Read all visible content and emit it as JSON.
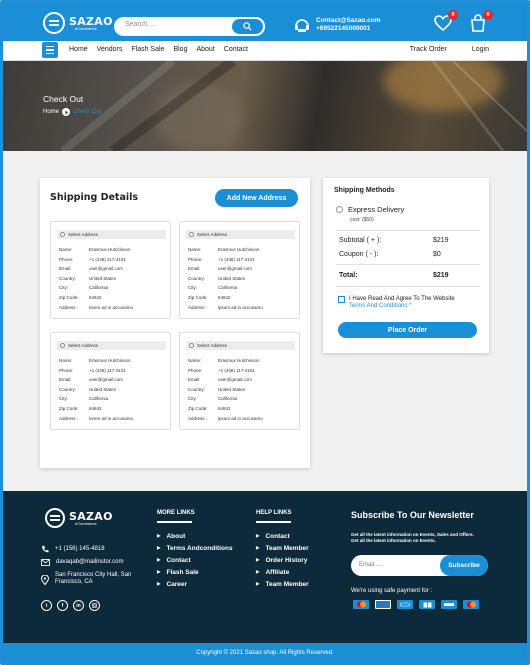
{
  "brand": {
    "name": "SAZAO",
    "tagline": "eCommerce"
  },
  "header": {
    "search_placeholder": "Search.....",
    "email": "Contact@Sazao.com",
    "phone": "+69522145000001",
    "wishlist_count": "0",
    "cart_count": "0"
  },
  "nav": {
    "links": [
      "Home",
      "Vendors",
      "Flash Sale",
      "Blog",
      "About",
      "Contact"
    ],
    "track_order": "Track Order",
    "login": "Login"
  },
  "hero": {
    "title": "Check Out",
    "crumb_home": "Home",
    "crumb_current": "Check Out"
  },
  "shipping": {
    "title": "Shipping Details",
    "add_button": "Add New Address",
    "addresses": [
      {
        "select": "Select Address",
        "name_k": "Name:",
        "name": "Erasmus Hutchinson",
        "phone_k": "Phone:",
        "phone": "+1 (448) 117-4101",
        "email_k": "Email:",
        "email": "user@gmail.com",
        "country_k": "Country:",
        "country": "United States",
        "city_k": "City:",
        "city": "California",
        "zip_k": "Zip Code:",
        "zip": "64842",
        "address_k": "Address :",
        "address": "lorem ad in accusamu"
      },
      {
        "select": "Select Address",
        "name_k": "Name:",
        "name": "Erasmus Hutchinson",
        "phone_k": "Phone:",
        "phone": "+1 (448) 117-4101",
        "email_k": "Email:",
        "email": "user@gmail.com",
        "country_k": "Country:",
        "country": "United States",
        "city_k": "City:",
        "city": "California",
        "zip_k": "Zip Code:",
        "zip": "64842",
        "address_k": "Address :",
        "address": "lpsum ad in accusamu"
      },
      {
        "select": "Select Address",
        "name_k": "Name:",
        "name": "Erasmus Hutchinson",
        "phone_k": "Phone:",
        "phone": "+1 (448) 117-4101",
        "email_k": "Email:",
        "email": "user@gmail.com",
        "country_k": "Country:",
        "country": "United States",
        "city_k": "City:",
        "city": "California",
        "zip_k": "Zip Code:",
        "zip": "64842",
        "address_k": "Address :",
        "address": "lorem ad in accusamu"
      },
      {
        "select": "Select Address",
        "name_k": "Name:",
        "name": "Erasmus Hutchinson",
        "phone_k": "Phone:",
        "phone": "+1 (448) 117-4101",
        "email_k": "Email:",
        "email": "user@gmail.com",
        "country_k": "Country:",
        "country": "United States",
        "city_k": "City:",
        "city": "California",
        "zip_k": "Zip Code:",
        "zip": "64842",
        "address_k": "Address :",
        "address": "lpsum ad in accusamu"
      }
    ]
  },
  "methods": {
    "title": "Shipping Methods",
    "option": "Express Delivery",
    "option_cost": "cost: ($50)",
    "subtotal_label": "Subtotal ( + ):",
    "subtotal": "$219",
    "coupon_label": "Coupon ( - ):",
    "coupon": "$0",
    "total_label": "Total:",
    "total": "$219",
    "agree_text": "I Have Read And Agree To The Website",
    "agree_link": "Terms And Conditions *",
    "place_button": "Place Order"
  },
  "footer": {
    "phone": "+1 (156) 145-4818",
    "email": "davaqab@mailinstor.com",
    "address": "San Francisco City Hall, San Francisco, CA",
    "more_title": "MORE LINKS",
    "more_links": [
      "About",
      "Terms Andconditions",
      "Contact",
      "Flash Sale",
      "Career"
    ],
    "help_title": "HELP LINKS",
    "help_links": [
      "Contact",
      "Team Member",
      "Order History",
      "Affiliate",
      "Team Member"
    ],
    "newsletter_title": "Subscribe To Our Newsletter",
    "newsletter_sub": "Get all the latest information on Events, Sales and Offers. Get all the latest information on Events.",
    "email_placeholder": "Email.....",
    "subscribe": "Subscribe",
    "payment_label": "We're using safe payment for :",
    "payment_icons": [
      "mastercard-icon",
      "amex-icon",
      "paypal-icon",
      "card-icon",
      "visa-icon",
      "mastercard-icon"
    ],
    "copyright": "Copyright © 2021 Sazao shop. All Rights Reserved."
  },
  "colors": {
    "accent": "#1a8fd6",
    "footer_bg": "#0d2a3a",
    "badge": "#e8252f"
  }
}
